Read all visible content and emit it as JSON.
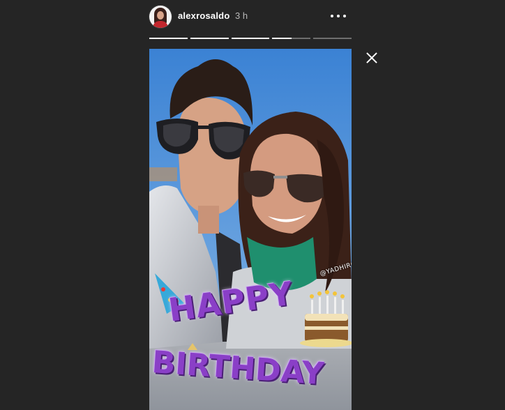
{
  "header": {
    "username": "alexrosaldo",
    "timestamp": "3 h",
    "more_icon": "more-horizontal-icon"
  },
  "progress": {
    "segments": [
      1,
      1,
      1,
      0.5,
      0
    ]
  },
  "story": {
    "mention": "@YADHIRO",
    "sticker": {
      "line1": "HAPPY",
      "line2": "BIRTHDAY"
    }
  },
  "close_icon": "close-icon",
  "colors": {
    "background": "#252525",
    "text_primary": "#ffffff",
    "text_secondary": "#b9b9b9",
    "sticker_purple": "#8a3fc7"
  }
}
